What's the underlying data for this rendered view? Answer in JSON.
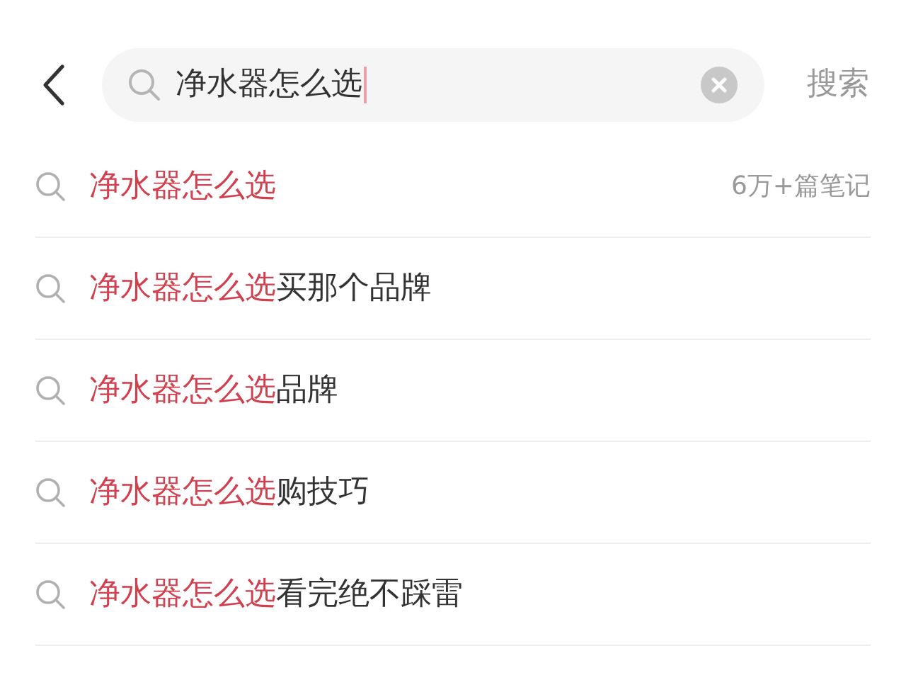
{
  "header": {
    "query": "净水器怎么选",
    "search_button": "搜索"
  },
  "suggestions": [
    {
      "match": "净水器怎么选",
      "count": "6万+篇笔记"
    },
    {
      "match": "净水器怎么选",
      "rest": "买那个品牌"
    },
    {
      "match": "净水器怎么选",
      "rest": "品牌"
    },
    {
      "match": "净水器怎么选",
      "rest": "购技巧"
    },
    {
      "match": "净水器怎么选",
      "rest": "看完绝不踩雷"
    }
  ]
}
